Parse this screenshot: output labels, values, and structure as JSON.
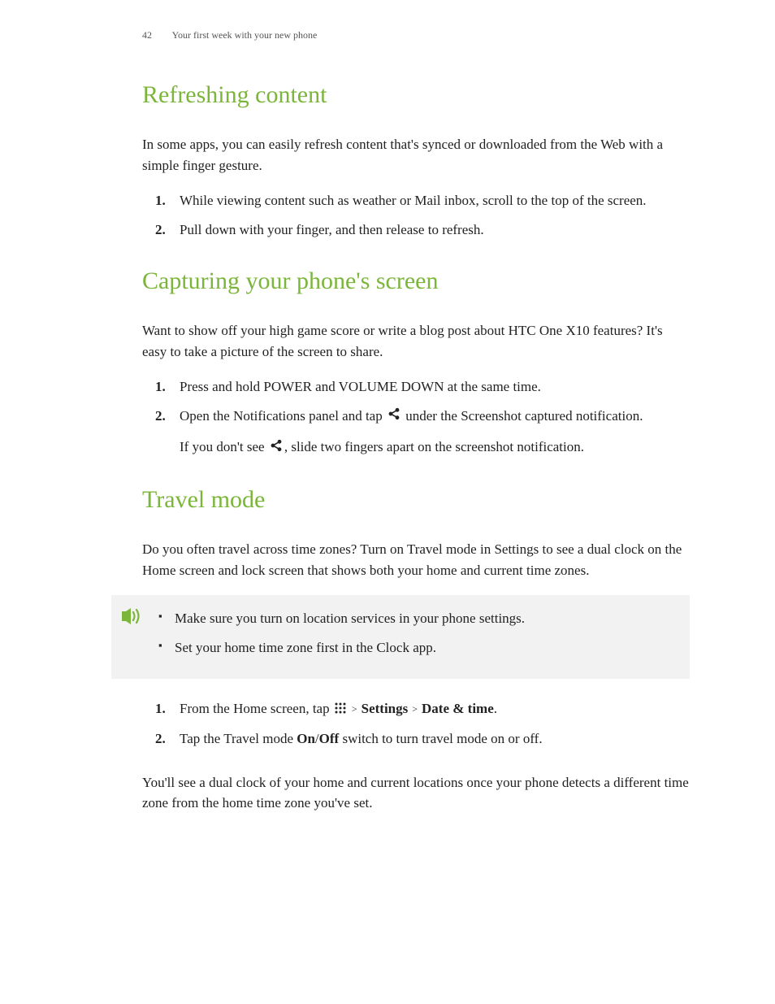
{
  "header": {
    "page_number": "42",
    "chapter_title": "Your first week with your new phone"
  },
  "sections": {
    "refreshing": {
      "heading": "Refreshing content",
      "intro": "In some apps, you can easily refresh content that's synced or downloaded from the Web with a simple finger gesture.",
      "steps": [
        "While viewing content such as weather or Mail inbox, scroll to the top of the screen.",
        "Pull down with your finger, and then release to refresh."
      ]
    },
    "capturing": {
      "heading": "Capturing your phone's screen",
      "intro": "Want to show off your high game score or write a blog post about HTC One X10 features? It's easy to take a picture of the screen to share.",
      "step1": "Press and hold POWER and VOLUME DOWN at the same time.",
      "step2_pre": "Open the Notifications panel and tap ",
      "step2_post": " under the Screenshot captured notification.",
      "step2_sub_pre": "If you don't see ",
      "step2_sub_post": ", slide two fingers apart on the screenshot notification."
    },
    "travel": {
      "heading": "Travel mode",
      "intro": "Do you often travel across time zones? Turn on Travel mode in Settings to see a dual clock on the Home screen and lock screen that shows both your home and current time zones.",
      "tips": [
        "Make sure you turn on location services in your phone settings.",
        "Set your home time zone first in the Clock app."
      ],
      "step1_pre": "From the Home screen, tap ",
      "step1_settings": "Settings",
      "step1_datetime": "Date & time",
      "step1_period": ".",
      "step2_pre": "Tap the Travel mode ",
      "step2_on": "On",
      "step2_slash": "/",
      "step2_off": "Off",
      "step2_post": " switch to turn travel mode on or off.",
      "outro": "You'll see a dual clock of your home and current locations once your phone detects a different time zone from the home time zone you've set."
    }
  }
}
